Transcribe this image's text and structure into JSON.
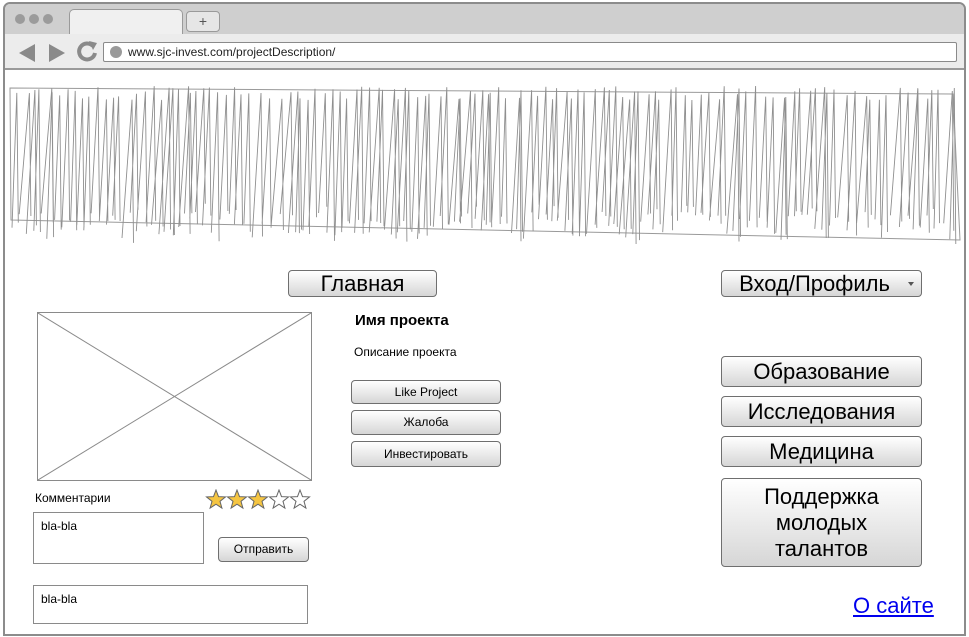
{
  "browser": {
    "url": "www.sjc-invest.com/projectDescription/",
    "new_tab_label": "+"
  },
  "nav": {
    "home_label": "Главная",
    "login_label": "Вход/Профиль"
  },
  "project": {
    "name": "Имя проекта",
    "description": "Описание проекта",
    "like_label": "Like Project",
    "complaint_label": "Жалоба",
    "invest_label": "Инвестировать"
  },
  "comments": {
    "label": "Комментарии",
    "input_value": "bla-bla",
    "send_label": "Отправить",
    "existing_comment": "bla-bla",
    "rating": 3,
    "rating_max": 5
  },
  "categories": [
    {
      "label": "Образование"
    },
    {
      "label": "Исследования"
    },
    {
      "label": "Медицина"
    },
    {
      "label": "Поддержка молодых талантов"
    }
  ],
  "footer": {
    "about_label": "О сайте"
  },
  "colors": {
    "star_fill": "#f5c542",
    "link": "#0000ee"
  }
}
